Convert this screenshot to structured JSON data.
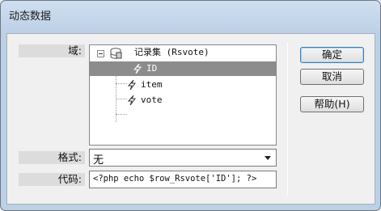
{
  "window": {
    "title": "动态数据"
  },
  "labels": {
    "domain": "域:",
    "format": "格式:",
    "code": "代码:"
  },
  "tree": {
    "root": {
      "label": "记录集 (Rsvote)",
      "icon": "database-icon"
    },
    "fields": [
      {
        "label": "ID",
        "icon": "lightning-icon",
        "selected": true
      },
      {
        "label": "item",
        "icon": "lightning-icon",
        "selected": false
      },
      {
        "label": "vote",
        "icon": "lightning-icon",
        "selected": false
      }
    ]
  },
  "format": {
    "selected": "无"
  },
  "code": {
    "value": "<?php echo $row_Rsvote['ID']; ?>"
  },
  "buttons": {
    "ok": "确定",
    "cancel": "取消",
    "help": "帮助(H)"
  },
  "colors": {
    "selection": "#8c8c8c",
    "title_bar": "#bcd0e6"
  }
}
